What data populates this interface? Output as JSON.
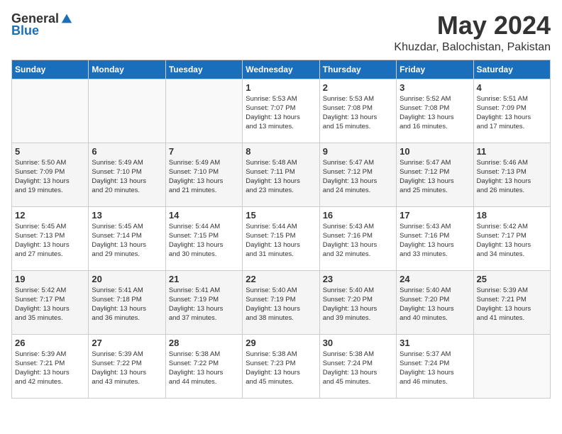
{
  "header": {
    "logo_general": "General",
    "logo_blue": "Blue",
    "month": "May 2024",
    "location": "Khuzdar, Balochistan, Pakistan"
  },
  "days_of_week": [
    "Sunday",
    "Monday",
    "Tuesday",
    "Wednesday",
    "Thursday",
    "Friday",
    "Saturday"
  ],
  "weeks": [
    [
      {
        "day": "",
        "info": ""
      },
      {
        "day": "",
        "info": ""
      },
      {
        "day": "",
        "info": ""
      },
      {
        "day": "1",
        "info": "Sunrise: 5:53 AM\nSunset: 7:07 PM\nDaylight: 13 hours\nand 13 minutes."
      },
      {
        "day": "2",
        "info": "Sunrise: 5:53 AM\nSunset: 7:08 PM\nDaylight: 13 hours\nand 15 minutes."
      },
      {
        "day": "3",
        "info": "Sunrise: 5:52 AM\nSunset: 7:08 PM\nDaylight: 13 hours\nand 16 minutes."
      },
      {
        "day": "4",
        "info": "Sunrise: 5:51 AM\nSunset: 7:09 PM\nDaylight: 13 hours\nand 17 minutes."
      }
    ],
    [
      {
        "day": "5",
        "info": "Sunrise: 5:50 AM\nSunset: 7:09 PM\nDaylight: 13 hours\nand 19 minutes."
      },
      {
        "day": "6",
        "info": "Sunrise: 5:49 AM\nSunset: 7:10 PM\nDaylight: 13 hours\nand 20 minutes."
      },
      {
        "day": "7",
        "info": "Sunrise: 5:49 AM\nSunset: 7:10 PM\nDaylight: 13 hours\nand 21 minutes."
      },
      {
        "day": "8",
        "info": "Sunrise: 5:48 AM\nSunset: 7:11 PM\nDaylight: 13 hours\nand 23 minutes."
      },
      {
        "day": "9",
        "info": "Sunrise: 5:47 AM\nSunset: 7:12 PM\nDaylight: 13 hours\nand 24 minutes."
      },
      {
        "day": "10",
        "info": "Sunrise: 5:47 AM\nSunset: 7:12 PM\nDaylight: 13 hours\nand 25 minutes."
      },
      {
        "day": "11",
        "info": "Sunrise: 5:46 AM\nSunset: 7:13 PM\nDaylight: 13 hours\nand 26 minutes."
      }
    ],
    [
      {
        "day": "12",
        "info": "Sunrise: 5:45 AM\nSunset: 7:13 PM\nDaylight: 13 hours\nand 27 minutes."
      },
      {
        "day": "13",
        "info": "Sunrise: 5:45 AM\nSunset: 7:14 PM\nDaylight: 13 hours\nand 29 minutes."
      },
      {
        "day": "14",
        "info": "Sunrise: 5:44 AM\nSunset: 7:15 PM\nDaylight: 13 hours\nand 30 minutes."
      },
      {
        "day": "15",
        "info": "Sunrise: 5:44 AM\nSunset: 7:15 PM\nDaylight: 13 hours\nand 31 minutes."
      },
      {
        "day": "16",
        "info": "Sunrise: 5:43 AM\nSunset: 7:16 PM\nDaylight: 13 hours\nand 32 minutes."
      },
      {
        "day": "17",
        "info": "Sunrise: 5:43 AM\nSunset: 7:16 PM\nDaylight: 13 hours\nand 33 minutes."
      },
      {
        "day": "18",
        "info": "Sunrise: 5:42 AM\nSunset: 7:17 PM\nDaylight: 13 hours\nand 34 minutes."
      }
    ],
    [
      {
        "day": "19",
        "info": "Sunrise: 5:42 AM\nSunset: 7:17 PM\nDaylight: 13 hours\nand 35 minutes."
      },
      {
        "day": "20",
        "info": "Sunrise: 5:41 AM\nSunset: 7:18 PM\nDaylight: 13 hours\nand 36 minutes."
      },
      {
        "day": "21",
        "info": "Sunrise: 5:41 AM\nSunset: 7:19 PM\nDaylight: 13 hours\nand 37 minutes."
      },
      {
        "day": "22",
        "info": "Sunrise: 5:40 AM\nSunset: 7:19 PM\nDaylight: 13 hours\nand 38 minutes."
      },
      {
        "day": "23",
        "info": "Sunrise: 5:40 AM\nSunset: 7:20 PM\nDaylight: 13 hours\nand 39 minutes."
      },
      {
        "day": "24",
        "info": "Sunrise: 5:40 AM\nSunset: 7:20 PM\nDaylight: 13 hours\nand 40 minutes."
      },
      {
        "day": "25",
        "info": "Sunrise: 5:39 AM\nSunset: 7:21 PM\nDaylight: 13 hours\nand 41 minutes."
      }
    ],
    [
      {
        "day": "26",
        "info": "Sunrise: 5:39 AM\nSunset: 7:21 PM\nDaylight: 13 hours\nand 42 minutes."
      },
      {
        "day": "27",
        "info": "Sunrise: 5:39 AM\nSunset: 7:22 PM\nDaylight: 13 hours\nand 43 minutes."
      },
      {
        "day": "28",
        "info": "Sunrise: 5:38 AM\nSunset: 7:22 PM\nDaylight: 13 hours\nand 44 minutes."
      },
      {
        "day": "29",
        "info": "Sunrise: 5:38 AM\nSunset: 7:23 PM\nDaylight: 13 hours\nand 45 minutes."
      },
      {
        "day": "30",
        "info": "Sunrise: 5:38 AM\nSunset: 7:24 PM\nDaylight: 13 hours\nand 45 minutes."
      },
      {
        "day": "31",
        "info": "Sunrise: 5:37 AM\nSunset: 7:24 PM\nDaylight: 13 hours\nand 46 minutes."
      },
      {
        "day": "",
        "info": ""
      }
    ]
  ]
}
